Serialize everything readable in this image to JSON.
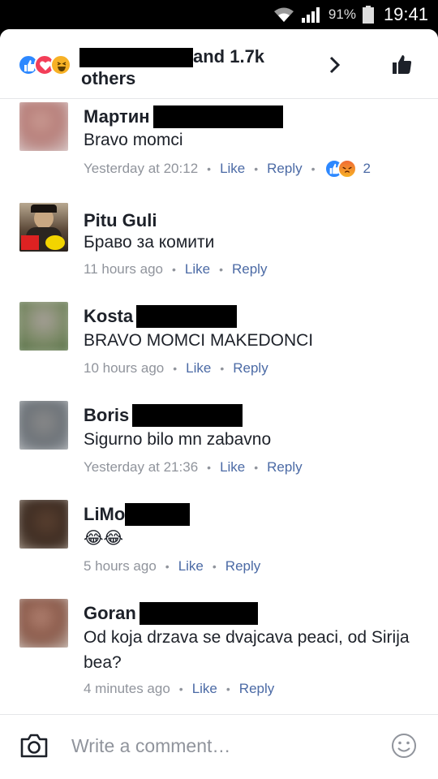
{
  "status_bar": {
    "battery": "91%",
    "time": "19:41"
  },
  "header": {
    "reactors_text": "and 1.7k others",
    "reaction_icons": [
      "like-icon",
      "love-icon",
      "haha-icon"
    ]
  },
  "comments": [
    {
      "name": "Мартин",
      "text": "Bravo momci",
      "time": "Yesterday at 20:12",
      "like": "Like",
      "reply": "Reply",
      "reaction_count": "2"
    },
    {
      "name": "Pitu Guli",
      "text": "Браво за комити",
      "time": "11 hours ago",
      "like": "Like",
      "reply": "Reply"
    },
    {
      "name": "Kosta",
      "text": "BRAVO MOMCI MAKEDONCI",
      "time": "10 hours ago",
      "like": "Like",
      "reply": "Reply"
    },
    {
      "name": "Boris",
      "text": "Sigurno bilo mn zabavno",
      "time": "Yesterday at 21:36",
      "like": "Like",
      "reply": "Reply"
    },
    {
      "name": "LiMo",
      "text": "😂😂",
      "time": "5 hours ago",
      "like": "Like",
      "reply": "Reply"
    },
    {
      "name": "Goran",
      "text": "Od koja drzava se dvajcava peaci, od Sirija bea?",
      "time": "4 minutes ago",
      "like": "Like",
      "reply": "Reply"
    }
  ],
  "composer": {
    "placeholder": "Write a comment…"
  },
  "colors": {
    "link": "#4b6aa5",
    "text": "#1d2129",
    "meta": "#90949c",
    "like_blue": "#2d88ff"
  }
}
